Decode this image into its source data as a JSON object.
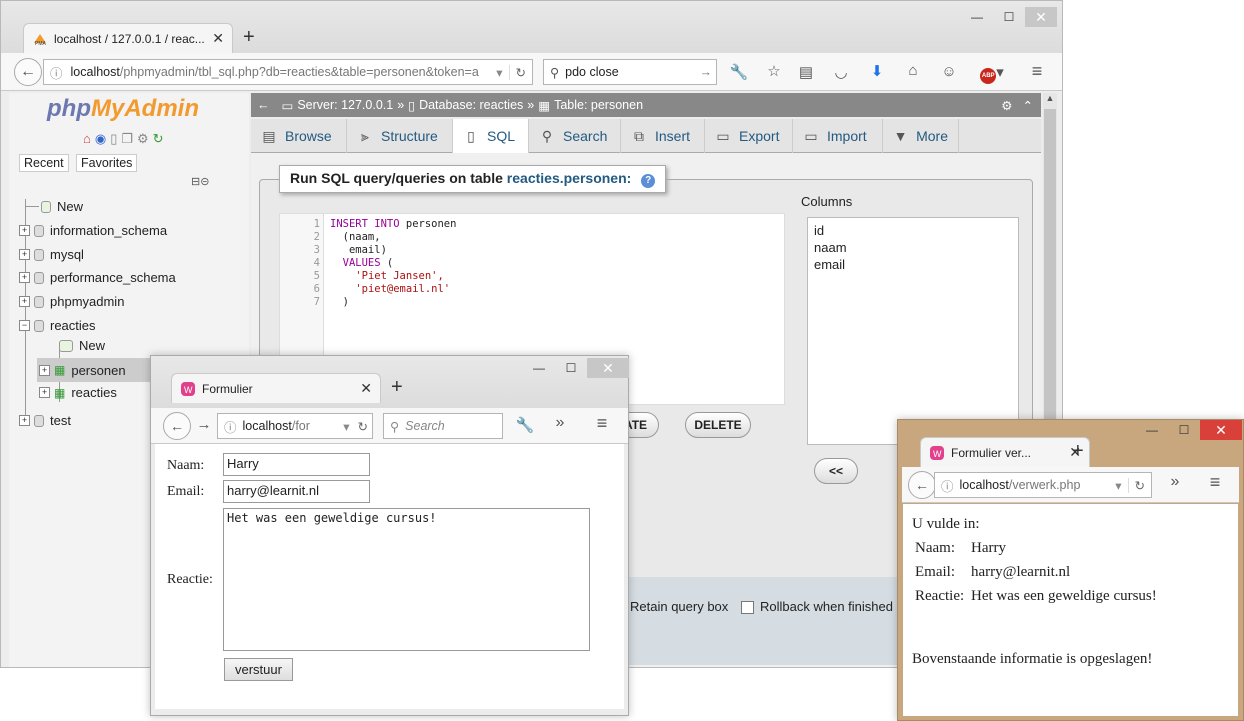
{
  "browser_main": {
    "tab_title": "localhost / 127.0.0.1 / reac...",
    "url_host": "localhost",
    "url_path": "/phpmyadmin/tbl_sql.php?db=reacties&table=personen&token=a",
    "search_value": "pdo close"
  },
  "pma": {
    "logo_php": "php",
    "logo_myadmin": "MyAdmin",
    "recent": "Recent",
    "favorites": "Favorites",
    "tree": [
      {
        "label": "New"
      },
      {
        "label": "information_schema"
      },
      {
        "label": "mysql"
      },
      {
        "label": "performance_schema"
      },
      {
        "label": "phpmyadmin"
      },
      {
        "label": "reacties"
      },
      {
        "label": "New"
      },
      {
        "label": "personen"
      },
      {
        "label": "reacties"
      },
      {
        "label": "test"
      }
    ],
    "breadcrumb": {
      "server": "Server: 127.0.0.1",
      "database": "Database: reacties",
      "table": "Table: personen",
      "sep": "»"
    },
    "tabs": [
      {
        "label": "Browse"
      },
      {
        "label": "Structure"
      },
      {
        "label": "SQL"
      },
      {
        "label": "Search"
      },
      {
        "label": "Insert"
      },
      {
        "label": "Export"
      },
      {
        "label": "Import"
      },
      {
        "label": "More"
      }
    ],
    "run_sql_prefix": "Run SQL query/queries on table",
    "run_sql_table": "reacties.personen:",
    "code_lines": [
      {
        "n": "1",
        "kw": "INSERT INTO",
        "rest": " personen",
        "str": ""
      },
      {
        "n": "2",
        "kw": "",
        "rest": "  (naam,",
        "str": ""
      },
      {
        "n": "3",
        "kw": "",
        "rest": "   email)",
        "str": ""
      },
      {
        "n": "4",
        "kw": "  VALUES",
        "rest": " (",
        "str": ""
      },
      {
        "n": "5",
        "kw": "",
        "rest": "    ",
        "str": "'Piet Jansen',"
      },
      {
        "n": "6",
        "kw": "",
        "rest": "    ",
        "str": "'piet@email.nl'"
      },
      {
        "n": "7",
        "kw": "",
        "rest": "  )",
        "str": ""
      }
    ],
    "columns_label": "Columns",
    "columns": [
      "id",
      "naam",
      "email"
    ],
    "btn_update_partial": "ATE",
    "btn_delete": "DELETE",
    "btn_insert_cols": "<<",
    "retain_label": "Retain query box",
    "rollback_label": "Rollback when finished"
  },
  "form_win": {
    "tab_title": "Formulier",
    "url_host": "localhost",
    "url_path": "/for",
    "search_placeholder": "Search",
    "naam_label": "Naam:",
    "naam_value": "Harry",
    "email_label": "Email:",
    "email_value": "harry@learnit.nl",
    "reactie_label": "Reactie:",
    "reactie_value": "Het was een geweldige cursus!",
    "submit": "verstuur"
  },
  "result_win": {
    "tab_title": "Formulier ver...",
    "url_host": "localhost",
    "url_path": "/verwerk.php",
    "intro": "U vulde in:",
    "rows": [
      {
        "label": "Naam:",
        "value": "Harry"
      },
      {
        "label": "Email:",
        "value": "harry@learnit.nl"
      },
      {
        "label": "Reactie:",
        "value": "Het was een geweldige cursus!"
      }
    ],
    "saved_msg": "Bovenstaande informatie is opgeslagen!"
  },
  "colors": {
    "pma_link": "#235a81",
    "crumb_bg": "#888888",
    "result_frame": "#c8a67e",
    "close_red": "#d9403a"
  }
}
